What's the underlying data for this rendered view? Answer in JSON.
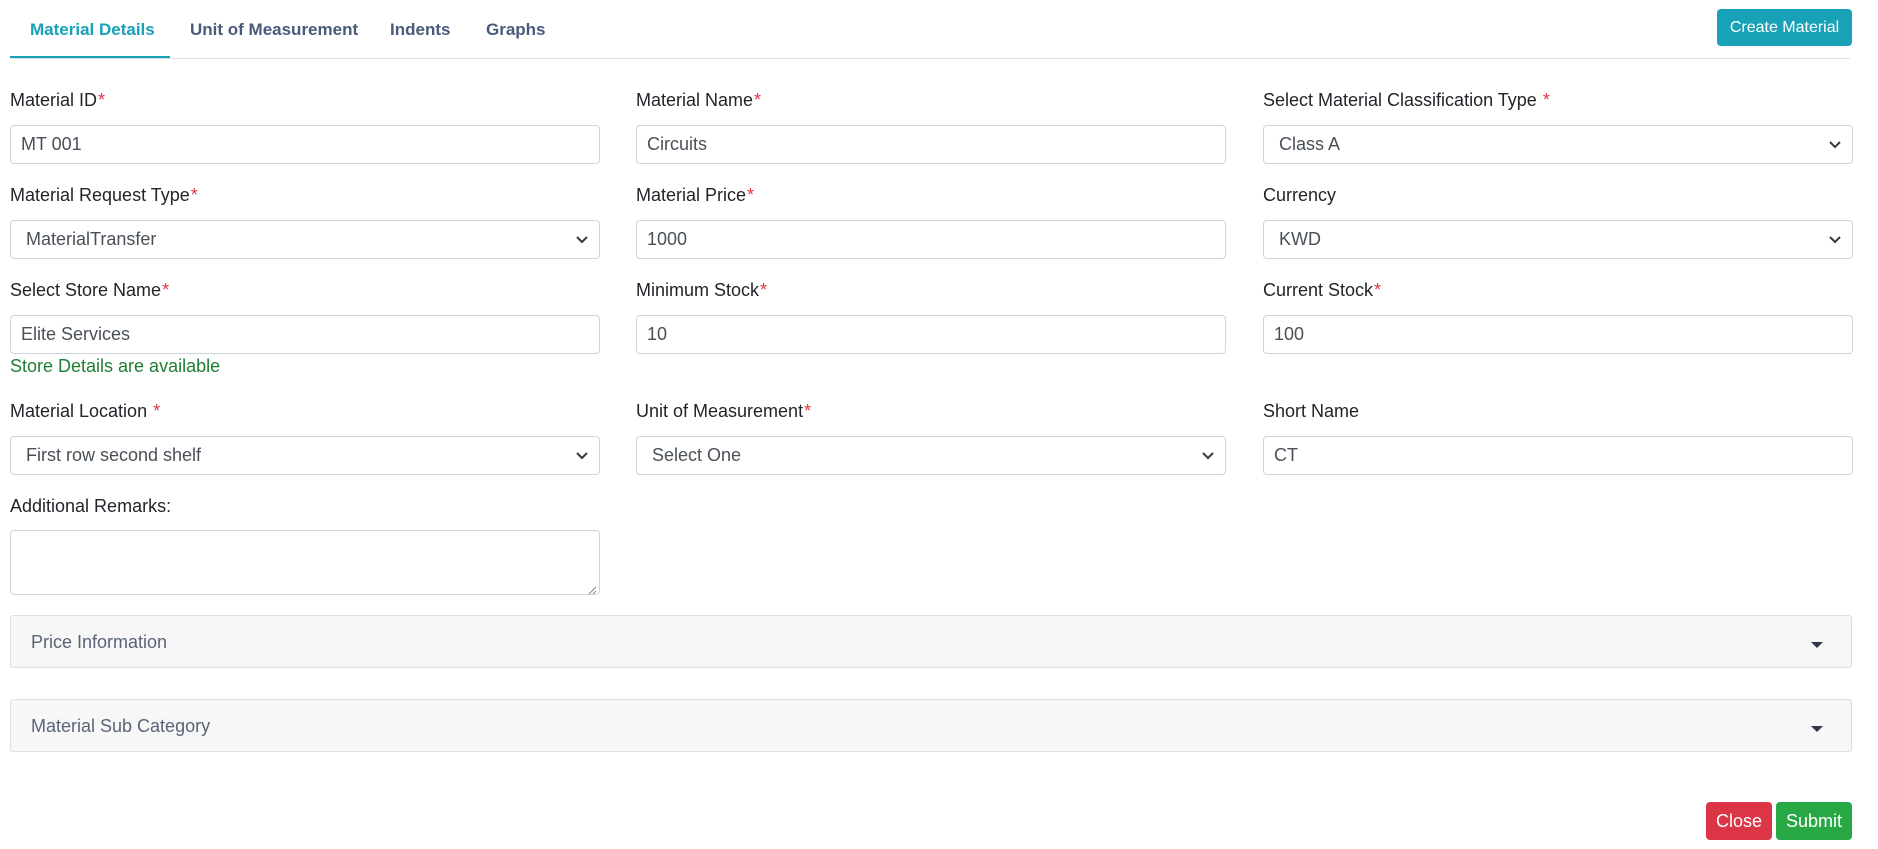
{
  "tabs": [
    {
      "label": "Material Details",
      "active": true
    },
    {
      "label": "Unit of Measurement",
      "active": false
    },
    {
      "label": "Indents",
      "active": false
    },
    {
      "label": "Graphs",
      "active": false
    }
  ],
  "create_button": "Create Material",
  "form": {
    "material_id": {
      "label": "Material ID",
      "required": "*",
      "value": "MT 001"
    },
    "material_name": {
      "label": "Material Name",
      "required": "*",
      "value": "Circuits"
    },
    "classification_type": {
      "label": "Select Material Classification Type",
      "required": "*",
      "value": "Class A"
    },
    "request_type": {
      "label": "Material Request Type",
      "required": "*",
      "value": "MaterialTransfer"
    },
    "material_price": {
      "label": "Material Price",
      "required": "*",
      "value": "1000"
    },
    "currency": {
      "label": "Currency",
      "value": "KWD"
    },
    "store_name": {
      "label": "Select Store Name",
      "required": "*",
      "value": "Elite Services",
      "note": "Store Details are available"
    },
    "minimum_stock": {
      "label": "Minimum Stock",
      "required": "*",
      "value": "10"
    },
    "current_stock": {
      "label": "Current Stock",
      "required": "*",
      "value": "100"
    },
    "material_location": {
      "label": "Material Location",
      "required": "*",
      "value": "First row second shelf"
    },
    "unit_of_measurement": {
      "label": "Unit of Measurement",
      "required": "*",
      "value": "Select One"
    },
    "short_name": {
      "label": "Short Name",
      "value": "CT"
    },
    "additional_remarks": {
      "label": "Additional Remarks:",
      "value": ""
    }
  },
  "accordions": [
    {
      "title": "Price Information"
    },
    {
      "title": "Material Sub Category"
    }
  ],
  "footer": {
    "close_label": "Close",
    "submit_label": "Submit"
  },
  "colors": {
    "accent": "#17a2b8",
    "danger": "#dc3545",
    "success": "#28a745",
    "note": "#1e7e34"
  }
}
